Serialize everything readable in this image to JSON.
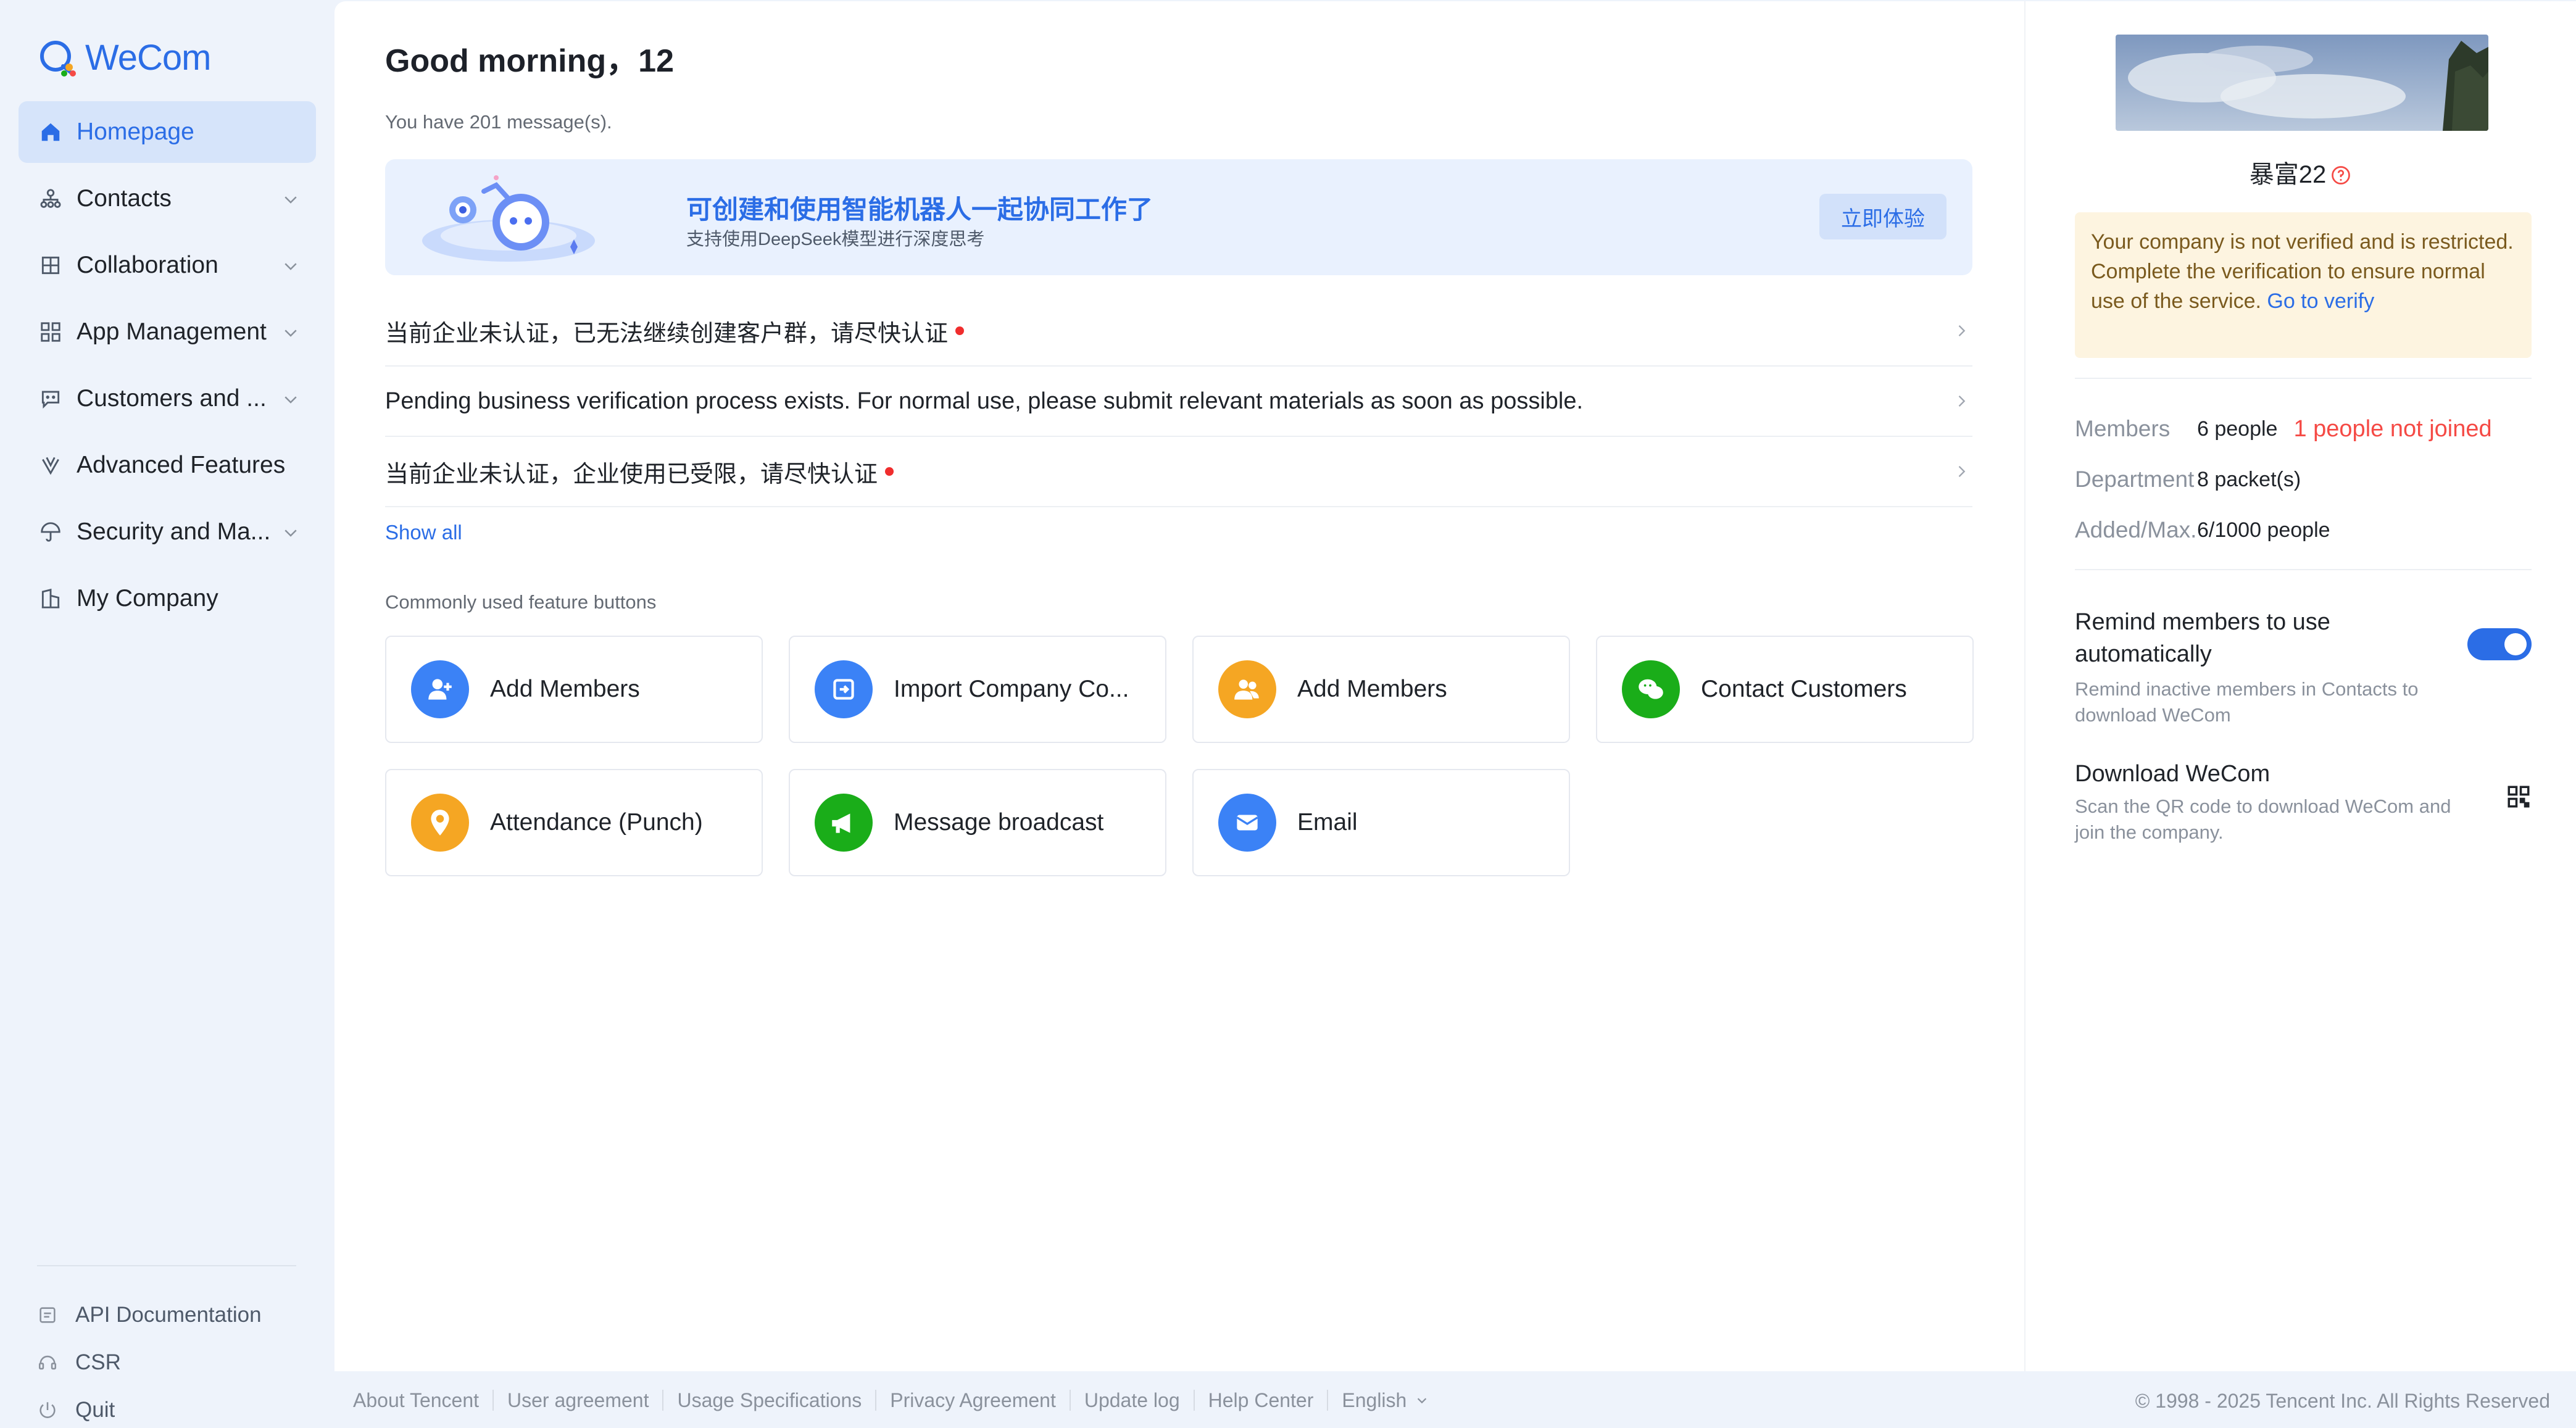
{
  "app": {
    "name": "WeCom",
    "accent": "#2b6de6"
  },
  "sidebar": {
    "items": [
      {
        "label": "Homepage",
        "icon": "home-icon",
        "active": true
      },
      {
        "label": "Contacts",
        "icon": "contacts-icon",
        "expandable": true
      },
      {
        "label": "Collaboration",
        "icon": "collaboration-icon",
        "expandable": true
      },
      {
        "label": "App Management",
        "icon": "grid-icon",
        "expandable": true
      },
      {
        "label": "Customers and ...",
        "icon": "chat-icon",
        "expandable": true
      },
      {
        "label": "Advanced Features",
        "icon": "advanced-icon"
      },
      {
        "label": "Security and Ma...",
        "icon": "umbrella-icon",
        "expandable": true
      },
      {
        "label": "My Company",
        "icon": "building-icon"
      }
    ],
    "bottom": [
      {
        "label": "API Documentation",
        "icon": "document-icon"
      },
      {
        "label": "CSR",
        "icon": "csr-icon"
      },
      {
        "label": "Quit",
        "icon": "power-icon"
      }
    ]
  },
  "main": {
    "greeting": "Good morning，12",
    "message_count": "You have 201 message(s).",
    "banner": {
      "title": "可创建和使用智能机器人一起协同工作了",
      "subtitle": "支持使用DeepSeek模型进行深度思考",
      "button": "立即体验"
    },
    "notices": [
      {
        "text": "当前企业未认证，已无法继续创建客户群，请尽快认证",
        "dot": true
      },
      {
        "text": "Pending business verification process exists. For normal use, please submit relevant materials as soon as possible.",
        "dot": false
      },
      {
        "text": "当前企业未认证，企业使用已受限，请尽快认证",
        "dot": true
      }
    ],
    "show_all": "Show all",
    "features_label": "Commonly used feature buttons",
    "features": [
      {
        "label": "Add Members",
        "icon": "add-member-icon",
        "color": "#3b82f6"
      },
      {
        "label": "Import Company Co...",
        "icon": "import-icon",
        "color": "#3b82f6"
      },
      {
        "label": "Add Members",
        "icon": "add-members-group-icon",
        "color": "#f5a623"
      },
      {
        "label": "Contact Customers",
        "icon": "wechat-icon",
        "color": "#1aad19"
      },
      {
        "label": "Attendance (Punch)",
        "icon": "location-icon",
        "color": "#f5a623"
      },
      {
        "label": "Message broadcast",
        "icon": "megaphone-icon",
        "color": "#1aad19"
      },
      {
        "label": "Email",
        "icon": "mail-icon",
        "color": "#3b82f6"
      }
    ]
  },
  "right": {
    "company_name": "暴富22",
    "warning": {
      "text": "Your company is not verified and is restricted. Complete the verification to ensure normal use of the service. ",
      "link": "Go to verify"
    },
    "stats": {
      "members_label": "Members",
      "members_value": "6 people",
      "members_not_joined": "1 people not joined",
      "department_label": "Department",
      "department_value": "8 packet(s)",
      "added_label": "Added/Max.",
      "added_value": "6/1000 people"
    },
    "remind": {
      "title": "Remind members to use automatically",
      "subtitle": "Remind inactive members in Contacts to download WeCom",
      "enabled": true
    },
    "download": {
      "title": "Download WeCom",
      "subtitle": "Scan the QR code to download WeCom and join the company."
    }
  },
  "footer": {
    "links": [
      "About Tencent",
      "User agreement",
      "Usage Specifications",
      "Privacy Agreement",
      "Update log",
      "Help Center"
    ],
    "language": "English",
    "copyright": "© 1998 - 2025 Tencent Inc. All Rights Reserved"
  }
}
